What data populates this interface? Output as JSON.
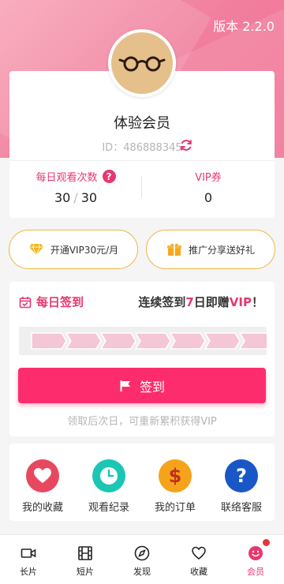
{
  "header": {
    "version": "版本 2.2.0"
  },
  "profile": {
    "name": "体验会员",
    "id_text": "ID：486888345"
  },
  "stats": {
    "daily_views_label": "每日观看次数",
    "daily_views_used": "30",
    "daily_views_sep": "/",
    "daily_views_total": "30",
    "vip_coupon_label": "VIP券",
    "vip_coupon_value": "0"
  },
  "promos": {
    "vip_label": "开通VIP30元/月",
    "share_label": "推广分享送好礼"
  },
  "checkin": {
    "title": "每日签到",
    "promo_prefix": "连续签到",
    "promo_days": "7",
    "promo_middle": "日即赠",
    "promo_vip": "VIP",
    "promo_suffix": "！",
    "button_label": "签到",
    "note": "领取后次日，可重新累积获得VIP",
    "days_total": 7,
    "days_completed": 0
  },
  "quick_links": [
    {
      "label": "我的收藏",
      "icon": "heart-icon",
      "color": "#e8485f"
    },
    {
      "label": "观看纪录",
      "icon": "clock-icon",
      "color": "#1bc6b4"
    },
    {
      "label": "我的订单",
      "icon": "dollar-icon",
      "color": "#f5a31a"
    },
    {
      "label": "联络客服",
      "icon": "question-icon",
      "color": "#1a57c6"
    }
  ],
  "tabs": [
    {
      "label": "长片",
      "icon": "video-icon"
    },
    {
      "label": "短片",
      "icon": "film-icon"
    },
    {
      "label": "发现",
      "icon": "compass-icon"
    },
    {
      "label": "收藏",
      "icon": "heart-outline-icon"
    },
    {
      "label": "会员",
      "icon": "smiley-icon",
      "active": true
    }
  ],
  "colors": {
    "accent": "#e7386e",
    "button": "#fd2d6d",
    "gold": "#f0b442"
  }
}
